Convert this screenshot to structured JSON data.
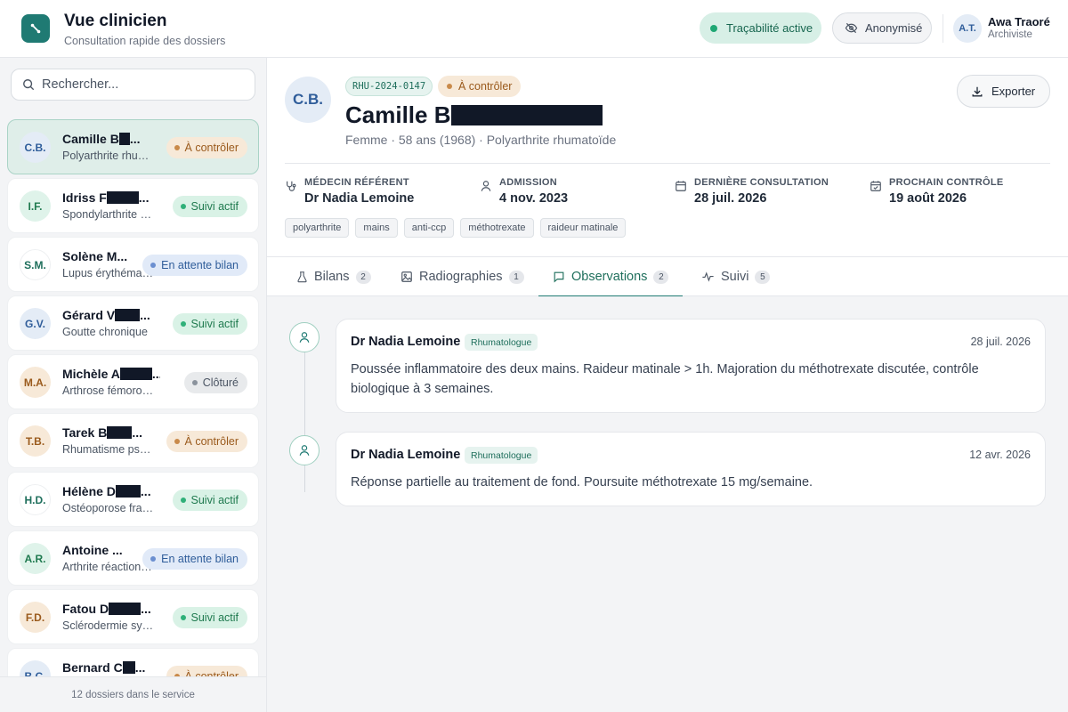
{
  "header": {
    "app_title": "Vue clinicien",
    "app_subtitle": "Consultation rapide des dossiers",
    "trace_label": "Traçabilité active",
    "anon_label": "Anonymisé",
    "user": {
      "initials": "A.T.",
      "name": "Awa Traoré",
      "role": "Archiviste"
    }
  },
  "colors": {
    "accent": "#1f7a73",
    "accent_soft": "#dfeee9"
  },
  "sidebar": {
    "search_placeholder": "Rechercher...",
    "footer": "12 dossiers dans le service",
    "patients": [
      {
        "initials": "C.B.",
        "name": "Camille B",
        "diagnosis": "Polyarthrite rhumatoïde",
        "status": "À contrôler",
        "status_kind": "ctrl",
        "active": true
      },
      {
        "initials": "I.F.",
        "name": "Idriss F",
        "diagnosis": "Spondylarthrite ankylosante",
        "status": "Suivi actif",
        "status_kind": "suivi"
      },
      {
        "initials": "S.M.",
        "name": "Solène M...",
        "diagnosis": "Lupus érythémateux",
        "status": "En attente bilan",
        "status_kind": "attente"
      },
      {
        "initials": "G.V.",
        "name": "Gérard V",
        "diagnosis": "Goutte chronique",
        "status": "Suivi actif",
        "status_kind": "suivi"
      },
      {
        "initials": "M.A.",
        "name": "Michèle A",
        "diagnosis": "Arthrose fémoro-tibiale",
        "status": "Clôturé",
        "status_kind": "clot"
      },
      {
        "initials": "T.B.",
        "name": "Tarek B",
        "diagnosis": "Rhumatisme psoriasique",
        "status": "À contrôler",
        "status_kind": "ctrl"
      },
      {
        "initials": "H.D.",
        "name": "Hélène D",
        "diagnosis": "Ostéoporose fracturaire",
        "status": "Suivi actif",
        "status_kind": "suivi"
      },
      {
        "initials": "A.R.",
        "name": "Antoine ...",
        "diagnosis": "Arthrite réactionnelle",
        "status": "En attente bilan",
        "status_kind": "attente"
      },
      {
        "initials": "F.D.",
        "name": "Fatou D",
        "diagnosis": "Sclérodermie systémique",
        "status": "Suivi actif",
        "status_kind": "suivi"
      },
      {
        "initials": "B.C.",
        "name": "Bernard C",
        "diagnosis": "",
        "status": "À contrôler",
        "status_kind": "ctrl"
      }
    ]
  },
  "patient": {
    "initials": "C.B.",
    "record_id": "RHU-2024-0147",
    "status": "À contrôler",
    "name": "Camille B",
    "meta": "Femme · 58 ans (1968) · Polyarthrite rhumatoïde",
    "export_label": "Exporter",
    "info": [
      {
        "label": "MÉDECIN RÉFÉRENT",
        "value": "Dr Nadia Lemoine",
        "icon": "stethoscope-icon"
      },
      {
        "label": "ADMISSION",
        "value": "4 nov. 2023",
        "icon": "user-icon"
      },
      {
        "label": "DERNIÈRE CONSULTATION",
        "value": "28 juil. 2026",
        "icon": "calendar-icon"
      },
      {
        "label": "PROCHAIN CONTRÔLE",
        "value": "19 août 2026",
        "icon": "calendar-check-icon"
      }
    ],
    "tags": [
      "polyarthrite",
      "mains",
      "anti-ccp",
      "méthotrexate",
      "raideur matinale"
    ]
  },
  "tabs": [
    {
      "label": "Bilans",
      "count": "2",
      "icon": "flask-icon"
    },
    {
      "label": "Radiographies",
      "count": "1",
      "icon": "image-icon"
    },
    {
      "label": "Observations",
      "count": "2",
      "icon": "message-icon",
      "active": true
    },
    {
      "label": "Suivi",
      "count": "5",
      "icon": "activity-icon"
    }
  ],
  "observations": [
    {
      "author": "Dr Nadia Lemoine",
      "role": "Rhumatologue",
      "date": "28 juil. 2026",
      "text": "Poussée inflammatoire des deux mains. Raideur matinale > 1h. Majoration du méthotrexate discutée, contrôle biologique à 3 semaines."
    },
    {
      "author": "Dr Nadia Lemoine",
      "role": "Rhumatologue",
      "date": "12 avr. 2026",
      "text": "Réponse partielle au traitement de fond. Poursuite méthotrexate 15 mg/semaine."
    }
  ]
}
